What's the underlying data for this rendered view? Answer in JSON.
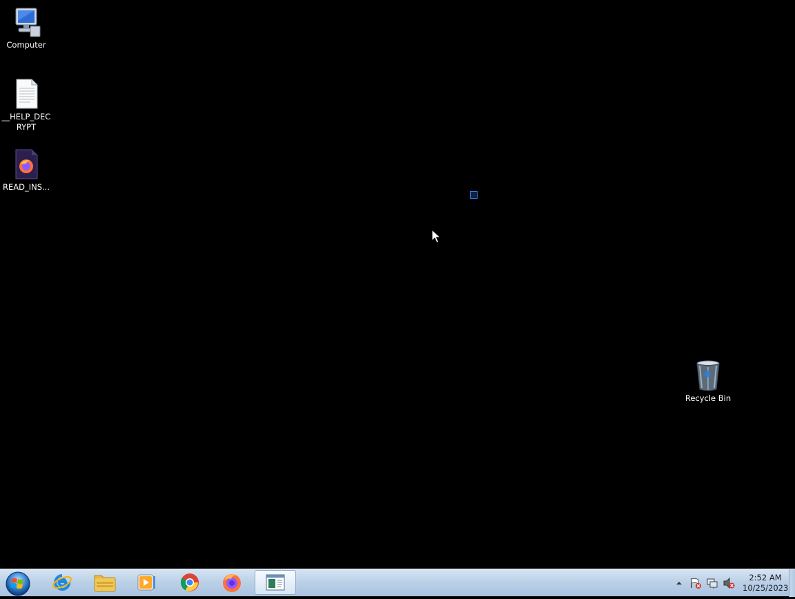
{
  "desktop": {
    "icons": [
      {
        "label": "Computer",
        "icon": "computer-icon"
      },
      {
        "label": "__HELP_DECRYPT",
        "icon": "text-file-icon"
      },
      {
        "label": "READ_INS...",
        "icon": "firefox-html-file-icon"
      },
      {
        "label": "Recycle Bin",
        "icon": "recycle-bin-icon"
      }
    ]
  },
  "taskbar": {
    "start": {
      "icon": "windows-orb-icon"
    },
    "pinned": [
      {
        "icon": "internet-explorer-icon"
      },
      {
        "icon": "file-explorer-icon"
      },
      {
        "icon": "media-player-icon"
      },
      {
        "icon": "chrome-icon"
      },
      {
        "icon": "firefox-icon"
      },
      {
        "icon": "notes-window-icon",
        "active": true
      }
    ],
    "tray": {
      "icons": [
        "show-hidden-arrow-icon",
        "action-center-flag-icon",
        "network-icon",
        "volume-muted-icon"
      ],
      "time": "2:52 AM",
      "date": "10/25/2023"
    }
  },
  "colors": {
    "desktop_background": "#000000",
    "taskbar_top": "#d6e4f2",
    "taskbar_bottom": "#a9c3e0"
  }
}
